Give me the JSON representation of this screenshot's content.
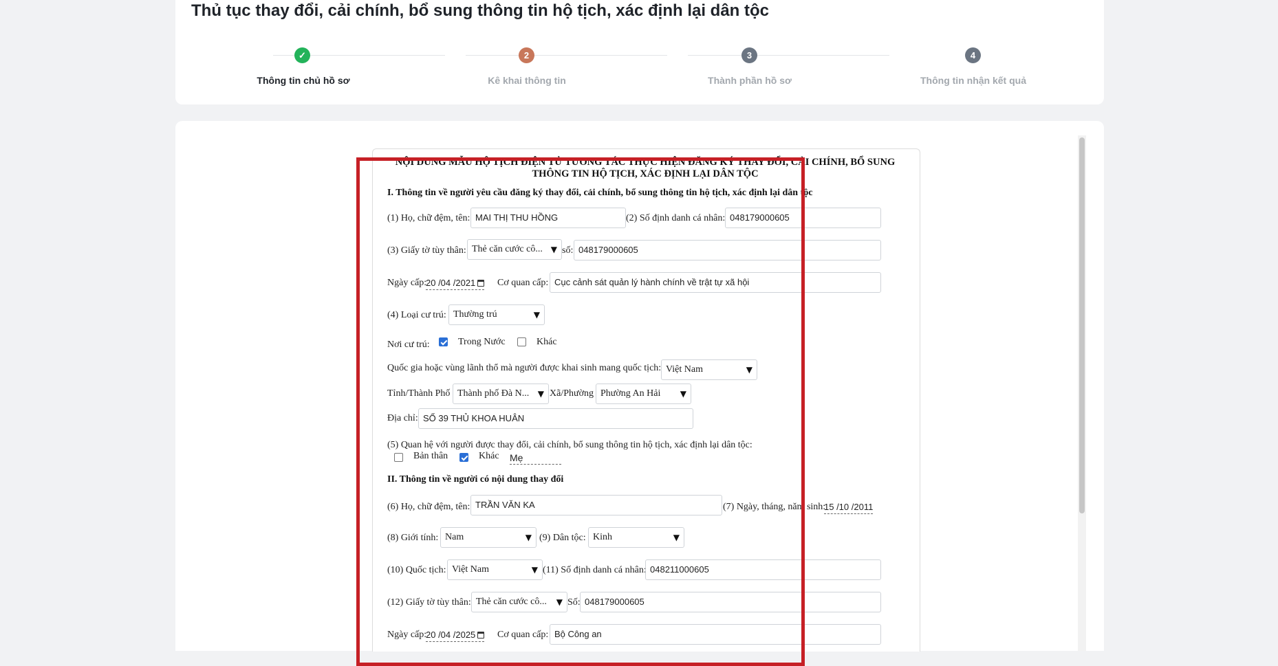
{
  "page_title": "Thủ tục thay đổi, cải chính, bổ sung thông tin hộ tịch, xác định lại dân tộc",
  "steps": [
    {
      "number": "✓",
      "label": "Thông tin chủ hồ sơ",
      "state": "done"
    },
    {
      "number": "2",
      "label": "Kê khai thông tin",
      "state": "active"
    },
    {
      "number": "3",
      "label": "Thành phần hồ sơ",
      "state": "todo"
    },
    {
      "number": "4",
      "label": "Thông tin nhận kết quả",
      "state": "todo"
    }
  ],
  "colors": {
    "done": "#23b35a",
    "active": "#c8775a",
    "todo": "#6b7582",
    "highlight": "#c62026",
    "checkbox": "#2a6fd6"
  },
  "form": {
    "title_line1": "NỘI DUNG MẪU HỘ TỊCH ĐIỆN TỬ TƯƠNG TÁC THỰC HIỆN ĐĂNG KÝ THAY ĐỔI, CẢI CHÍNH, BỔ SUNG",
    "title_line2": "THÔNG TIN HỘ TỊCH, XÁC ĐỊNH LẠI DÂN TỘC",
    "section1": "I. Thông tin về người yêu cầu đăng ký thay đổi, cải chính, bổ sung thông tin hộ tịch, xác định lại dân tộc",
    "s1": {
      "name_label": "(1) Họ, chữ đệm, tên:",
      "name_value": "MAI THỊ THU HỒNG",
      "id_label": "(2) Số định danh cá nhân:",
      "id_value": "048179000605",
      "doc_label": "(3) Giấy tờ tùy thân:",
      "doc_value": "Thẻ căn cước cô...",
      "doc_no_label": "số:",
      "doc_no_value": "048179000605",
      "issue_date_label": "Ngày cấp:",
      "issue_date_value": "20 /04 /2021",
      "issuer_label": "Cơ quan cấp:",
      "issuer_value": "Cục cảnh sát quản lý hành chính về trật tự xã hội",
      "residence_type_label": "(4) Loại cư trú:",
      "residence_type_value": "Thường trú",
      "residence_place_label": "Nơi cư trú:",
      "opt_domestic": "Trong Nước",
      "opt_other": "Khác",
      "country_label": "Quốc gia hoặc vùng lãnh thổ mà người được khai sinh mang quốc tịch:",
      "country_value": "Việt Nam",
      "province_label": "Tỉnh/Thành Phố",
      "province_value": "Thành phố Đà N...",
      "ward_label": "Xã/Phường",
      "ward_value": "Phường An Hải",
      "address_label": "Địa chỉ:",
      "address_value": "SỐ 39 THỦ KHOA HUÂN",
      "relation_label": "(5) Quan hệ với người được thay đổi, cải chính, bổ sung thông tin hộ tịch, xác định lại dân tộc:",
      "opt_self": "Bản thân",
      "opt_rel_other": "Khác",
      "relation_value": "Mẹ"
    },
    "section2": "II. Thông tin về người có nội dung thay đổi",
    "s2": {
      "name_label": "(6) Họ, chữ đệm, tên:",
      "name_value": "TRẦN VĂN KA",
      "dob_label": "(7) Ngày, tháng, năm sinh:",
      "dob_value": "15 /10 /2011",
      "gender_label": "(8) Giới tính:",
      "gender_value": "Nam",
      "ethnic_label": "(9) Dân tộc:",
      "ethnic_value": "Kinh",
      "nationality_label": "(10) Quốc tịch:",
      "nationality_value": "Việt Nam",
      "id_label": "(11) Số định danh cá nhân:",
      "id_value": "048211000605",
      "doc_label": "(12) Giấy tờ tùy thân:",
      "doc_value": "Thẻ căn cước cô...",
      "doc_no_label": "Số:",
      "doc_no_value": "048179000605",
      "issue_date_label": "Ngày cấp:",
      "issue_date_value": "20 /04 /2025",
      "issuer_label": "Cơ quan cấp:",
      "issuer_value": "Bộ Công an"
    }
  }
}
